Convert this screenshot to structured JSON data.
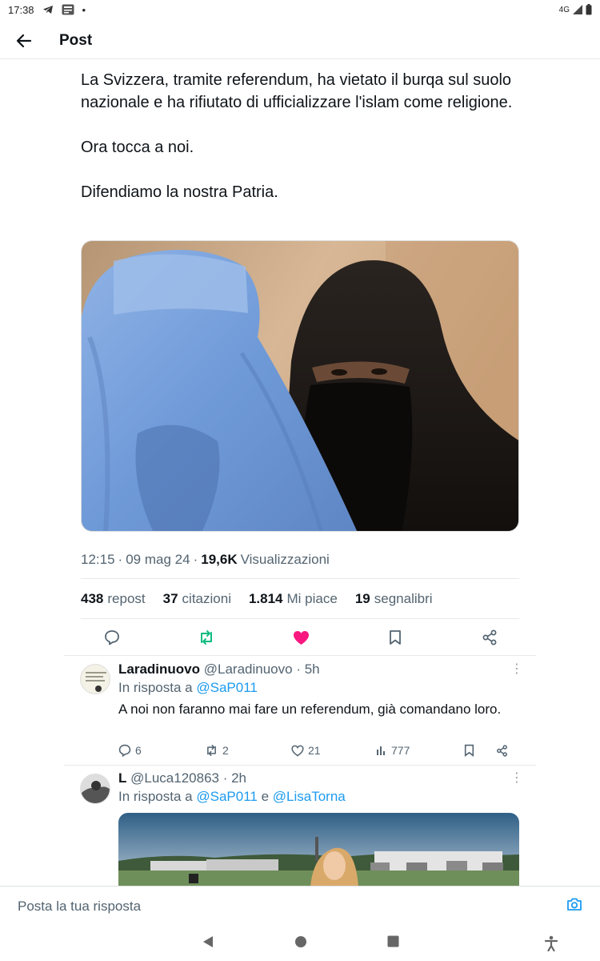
{
  "status_bar": {
    "time": "17:38",
    "dot": "•",
    "network": "4G"
  },
  "header": {
    "title": "Post"
  },
  "post": {
    "text": "La Svizzera, tramite referendum, ha vietato il burqa sul suolo nazionale e ha rifiutato di ufficializzare l'islam come religione.\n\nOra tocca a noi.\n\nDifendiamo la nostra Patria.",
    "time": "12:15",
    "sep": "·",
    "date": "09 mag 24",
    "views": "19,6K",
    "views_label": "Visualizzazioni",
    "stats": {
      "reposts": "438",
      "reposts_label": "repost",
      "quotes": "37",
      "quotes_label": "citazioni",
      "likes": "1.814",
      "likes_label": "Mi piace",
      "bookmarks": "19",
      "bookmarks_label": "segnalibri"
    },
    "colors": {
      "repost_green": "#00ba7c",
      "like_pink": "#f91880",
      "link_blue": "#1d9bf0"
    }
  },
  "replies": [
    {
      "name": "Laradinuovo",
      "handle": "@Laradinuovo",
      "time": "· 5h",
      "in_reply_prefix": "In risposta a",
      "mention1": "@SaP011",
      "text": "A noi non faranno mai fare un referendum, già comandano loro.",
      "replies": "6",
      "reposts": "2",
      "likes": "21",
      "views": "777"
    },
    {
      "name": "L",
      "handle": "@Luca120863",
      "time": "· 2h",
      "in_reply_prefix": "In risposta a",
      "mention1": "@SaP011",
      "conj": "e",
      "mention2": "@LisaTorna"
    }
  ],
  "compose": {
    "placeholder": "Posta la tua risposta"
  }
}
